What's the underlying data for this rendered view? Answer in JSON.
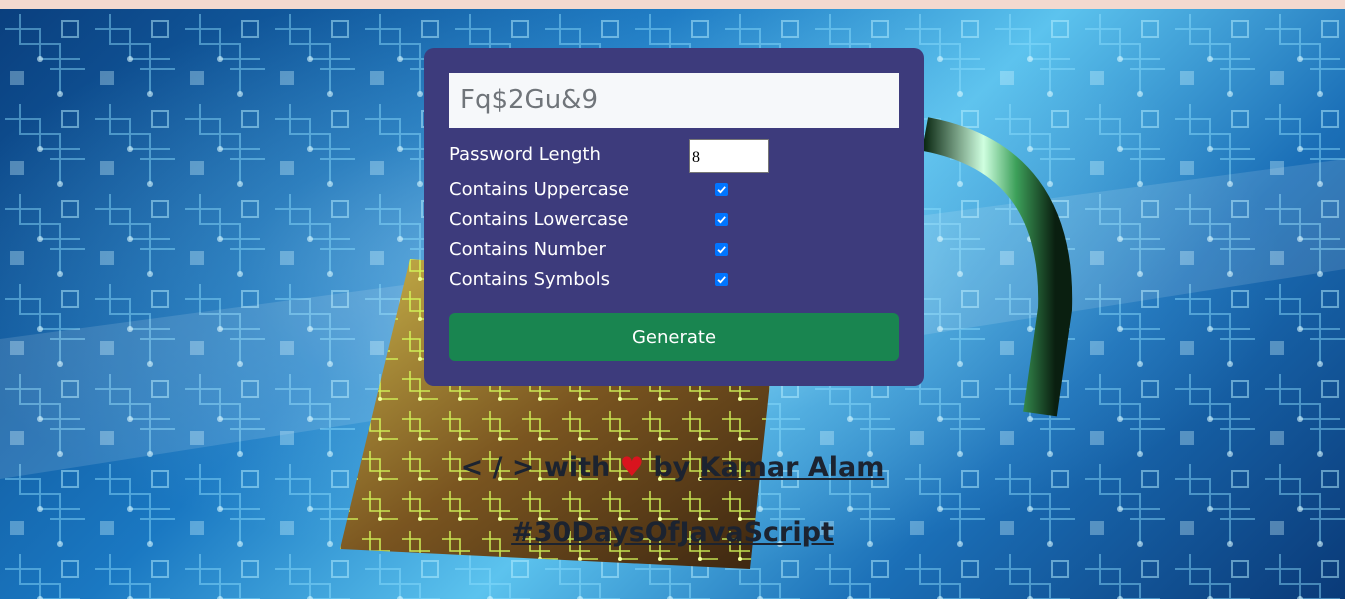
{
  "generator": {
    "password_value": "Fq$2Gu&9",
    "length_label": "Password Length",
    "length_value": "8",
    "options": [
      {
        "label": "Contains Uppercase",
        "checked": true
      },
      {
        "label": "Contains Lowercase",
        "checked": true
      },
      {
        "label": "Contains Number",
        "checked": true
      },
      {
        "label": "Contains Symbols",
        "checked": true
      }
    ],
    "generate_label": "Generate"
  },
  "footer": {
    "code_symbol": "< / >",
    "with_text": "with",
    "heart": "♥",
    "by_text": "by",
    "author_link": "Kamar Alam",
    "hashtag_link": "#30DaysOfJavaScript"
  },
  "colors": {
    "card": "#3d3b7c",
    "generate_button": "#198550",
    "checkbox": "#0075ff",
    "heart": "#d9141e"
  }
}
